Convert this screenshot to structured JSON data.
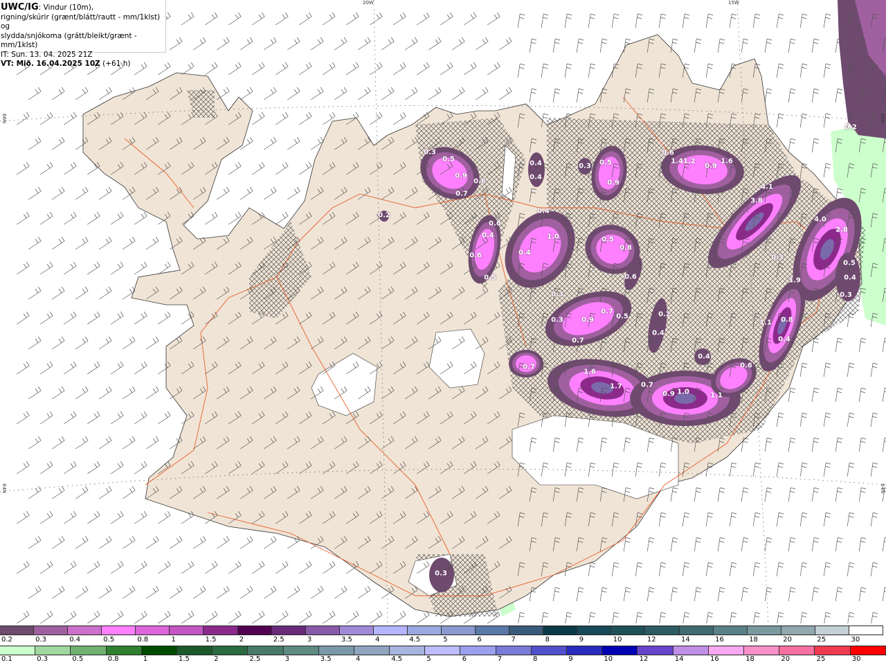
{
  "header": {
    "model": "UWC/IG",
    "line1": ": Vindur (10m),",
    "line2": "rigning/skúrir (grænt/blátt/rautt - mm/1klst) og",
    "line3": "slydda/snjókoma (grátt/bleikt/grænt - mm/1klst)",
    "it": "IT: Sun. 13. 04. 2025 21Z",
    "vt": "VT: Mið. 16.04.2025 10Z",
    "lead": " (+61 h)"
  },
  "grid_labels": {
    "lon_20w": "20W",
    "lon_15w": "15W",
    "lat_66n_left": "66N",
    "lat_66n_right": "66N",
    "lat_64n_left": "64N",
    "lat_64n_right": "64N"
  },
  "map": {
    "colors": {
      "land": "#f0e4d6",
      "ocean": "#ffffff",
      "glacier": "#ffffff",
      "roads": "#e8602a",
      "wind_barbs": "#555555",
      "hatch": "#3a3a3a",
      "rain_light": "#ccffcc"
    },
    "precip_values": [
      "0.3",
      "0.5",
      "0.9",
      "0.6",
      "0.7",
      "0.4",
      "0.4",
      "0.3",
      "0.5",
      "0.9",
      "0.6",
      "1.41.2",
      "0.9",
      "1.6",
      "0.2",
      "4.1",
      "3.8",
      "4.0",
      "2.8",
      "0.4",
      "0.6",
      "0.4",
      "1.0",
      "0.4",
      "0.5",
      "0.8",
      "0.6",
      "0.5",
      "0.6",
      "0.3",
      "0.5",
      "1.9",
      "0.4",
      "0.3",
      "0.3",
      "0.3",
      "0.9",
      "0.7",
      "0.5",
      "0.2",
      "0.4",
      "0.7",
      "1.1",
      "0.8",
      "0.4",
      "0.4",
      "0.6",
      "0.7",
      "1.6",
      "1.7",
      "0.7",
      "0.9",
      "1.0",
      "1.1",
      "0.3",
      "0.2"
    ]
  },
  "legend": {
    "snow": {
      "labels": [
        "0.2",
        "0.3",
        "0.4",
        "0.5",
        "0.8",
        "1",
        "1.5",
        "2",
        "2.5",
        "3",
        "3.5",
        "4",
        "4.5",
        "5",
        "6",
        "7",
        "8",
        "9",
        "10",
        "12",
        "14",
        "16",
        "18",
        "20",
        "25",
        "30"
      ],
      "colors": [
        "#6e4a6e",
        "#a060a0",
        "#cc70cc",
        "#ff80ff",
        "#dd66dd",
        "#c455c4",
        "#8c2a8c",
        "#520052",
        "#6a2a7a",
        "#8a5aaa",
        "#a08ad8",
        "#b4b4ff",
        "#9aaae0",
        "#8a9ad0",
        "#5a78a8",
        "#3a5a7a",
        "#0a3a48",
        "#164a58",
        "#1e5058",
        "#2e5a62",
        "#426a72",
        "#5a8088",
        "#7a9aa0",
        "#90a8ae",
        "#c4d0d4",
        "#ffffff"
      ]
    },
    "rain": {
      "labels": [
        "0.1",
        "0.3",
        "0.5",
        "0.8",
        "1",
        "1.5",
        "2",
        "2.5",
        "3",
        "3.5",
        "4",
        "4.5",
        "5",
        "6",
        "7",
        "8",
        "9",
        "10",
        "12",
        "14",
        "16",
        "18",
        "20",
        "25",
        "30"
      ],
      "colors": [
        "#ccffcc",
        "#a0d8a0",
        "#70b070",
        "#2e802e",
        "#004a00",
        "#1a5a2a",
        "#2a6a40",
        "#487a68",
        "#5e8a82",
        "#7a98a8",
        "#90a4c0",
        "#a8b4e0",
        "#bcbcff",
        "#9aa0ee",
        "#7a7ad8",
        "#5050cc",
        "#2a2ac0",
        "#0000b4",
        "#6644cc",
        "#c090e8",
        "#f8a8f0",
        "#f890c8",
        "#f870a0",
        "#f03a50",
        "#ff0000"
      ]
    }
  }
}
